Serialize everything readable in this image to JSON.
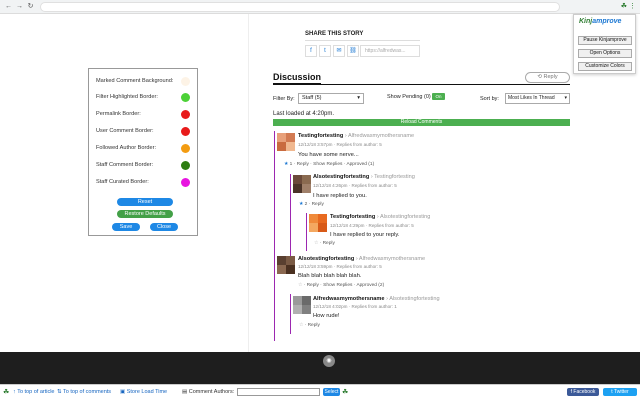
{
  "extension": {
    "brand_part1": "Kinj",
    "brand_part2": "amprove",
    "buttons": [
      "Pause Kinjamprove",
      "Open Options",
      "Customize Colors"
    ]
  },
  "settings": {
    "rows": [
      {
        "label": "Marked Comment Background:",
        "color": "#fdf3e6"
      },
      {
        "label": "Filter Highlighted Border:",
        "color": "#4cd137"
      },
      {
        "label": "Permalink Border:",
        "color": "#e81b1b"
      },
      {
        "label": "User Comment Border:",
        "color": "#e81b1b"
      },
      {
        "label": "Followed Author Border:",
        "color": "#f39c12"
      },
      {
        "label": "Staff Comment Border:",
        "color": "#2e7d12"
      },
      {
        "label": "Staff Curated Border:",
        "color": "#e814e0"
      }
    ],
    "reset_label": "Reset",
    "restore_label": "Restore Defaults",
    "save_label": "Save",
    "close_label": "Close"
  },
  "share": {
    "title": "SHARE THIS STORY",
    "url": "https://alfredwas..."
  },
  "discussion": {
    "title": "Discussion",
    "reply_label": "Reply",
    "filter_label": "Filter By:",
    "filter_value": "Staff (5)",
    "pending_label": "Show Pending (0)",
    "toggle_label": "On",
    "sort_label": "Sort by:",
    "sort_value": "Most Likes In Thread",
    "loaded_text": "Last loaded at 4:20pm.",
    "reload_label": "Reload Comments"
  },
  "comments": [
    {
      "author": "Testingfortesting",
      "parent": "Alfredwasmymothersname",
      "meta": "12/12/18 3:57pm · Replies from author: 5",
      "body": "You have some nerve...",
      "actions": "1 · Reply · Show Replies · Approved (1)",
      "star": "blue"
    },
    {
      "author": "Alsotestingfortesting",
      "parent": "Testingfortesting",
      "meta": "12/12/18 4:26pm · Replies from author: 5",
      "body": "I have replied to you.",
      "actions": "2 · Reply",
      "star": "blue"
    },
    {
      "author": "Testingfortesting",
      "parent": "Alsotestingfortesting",
      "meta": "12/12/18 4:29pm · Replies from author: 5",
      "body": "I have replied to your reply.",
      "actions": "· Reply",
      "star": "grey"
    },
    {
      "author": "Alsotestingfortesting",
      "parent": "Alfredwasmymothersname",
      "meta": "12/12/18 3:59pm · Replies from author: 5",
      "body": "Blah blah blah blah blah.",
      "actions": "· Reply · Show Replies · Approved (2)",
      "star": "grey"
    },
    {
      "author": "Alfredwasmymothersname",
      "parent": "Alsotestingfortesting",
      "meta": "12/12/18 4:02pm · Replies from author: 1",
      "body": "How rude!",
      "actions": "· Reply",
      "star": "grey"
    }
  ],
  "bottom": {
    "top_article": "To top of article",
    "top_comments": "To top of comments",
    "store_load": "Store Load Time",
    "comment_authors": "Comment Authors:",
    "select_label": "Select",
    "facebook_label": "Facebook",
    "twitter_label": "Twitter"
  }
}
